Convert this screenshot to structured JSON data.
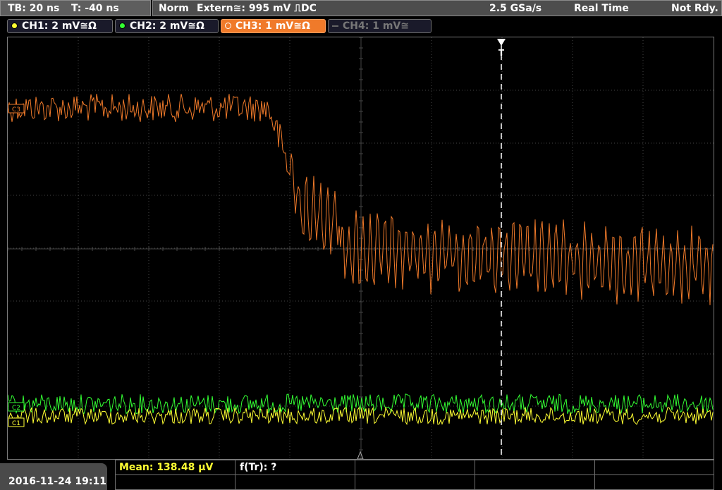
{
  "timebase": {
    "tb_label": "TB: 20 ns",
    "trigger_time": "T: -40 ns"
  },
  "status": {
    "mode": "Norm",
    "trigger_source": "Extern≅: 995 mV ⎍DC",
    "sample_rate": "2.5 GSa/s",
    "acq_mode": "Real Time",
    "state": "Not Rdy."
  },
  "channels": [
    {
      "label": "CH1: 2 mV≅Ω",
      "color": "#ffff33",
      "active": true
    },
    {
      "label": "CH2: 2 mV≅Ω",
      "color": "#33ff33",
      "active": true
    },
    {
      "label": "CH3: 1 mV≅Ω",
      "color": "#f07a2a",
      "active": true,
      "selected": true
    },
    {
      "label": "CH4: 1 mV≅",
      "color": "#777777",
      "active": false
    }
  ],
  "colors": {
    "ch1": "#ffff33",
    "ch2": "#33ff33",
    "ch3": "#f07a2a",
    "grid": "#444444"
  },
  "marker_labels": {
    "ch1": "C1",
    "ch2": "C2",
    "ch3": "C3"
  },
  "trigger_marker": "T",
  "datetime": "2016-11-24 19:11",
  "measurements": {
    "mean": "Mean: 138.48 μV",
    "ftr": "f(Tr): ?"
  }
}
